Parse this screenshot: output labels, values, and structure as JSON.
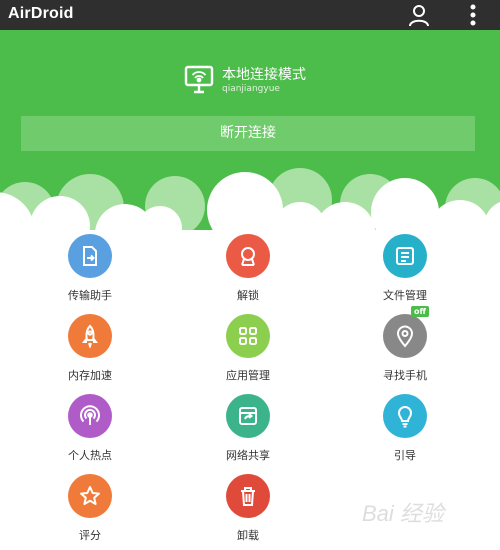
{
  "topbar": {
    "app_title": "AirDroid"
  },
  "connection": {
    "mode_title": "本地连接模式",
    "device_name": "qianjiangyue",
    "disconnect_label": "断开连接"
  },
  "tools": [
    {
      "label": "传输助手",
      "color": "#5aa0e0",
      "icon": "file-transfer-icon"
    },
    {
      "label": "解锁",
      "color": "#ea5a45",
      "icon": "unlock-icon"
    },
    {
      "label": "文件管理",
      "color": "#27b0c9",
      "icon": "file-manager-icon"
    },
    {
      "label": "内存加速",
      "color": "#f07a3a",
      "icon": "rocket-icon"
    },
    {
      "label": "应用管理",
      "color": "#8ccf4e",
      "icon": "app-grid-icon"
    },
    {
      "label": "寻找手机",
      "color": "#888888",
      "icon": "location-pin-icon",
      "badge": "off"
    },
    {
      "label": "个人热点",
      "color": "#b05cc8",
      "icon": "hotspot-icon"
    },
    {
      "label": "网络共享",
      "color": "#3bb48c",
      "icon": "network-share-icon"
    },
    {
      "label": "引导",
      "color": "#2fb3d6",
      "icon": "lightbulb-icon"
    },
    {
      "label": "评分",
      "color": "#f07a3a",
      "icon": "star-icon"
    },
    {
      "label": "卸载",
      "color": "#e04a3a",
      "icon": "trash-icon"
    }
  ],
  "watermark": "Bai 经验"
}
